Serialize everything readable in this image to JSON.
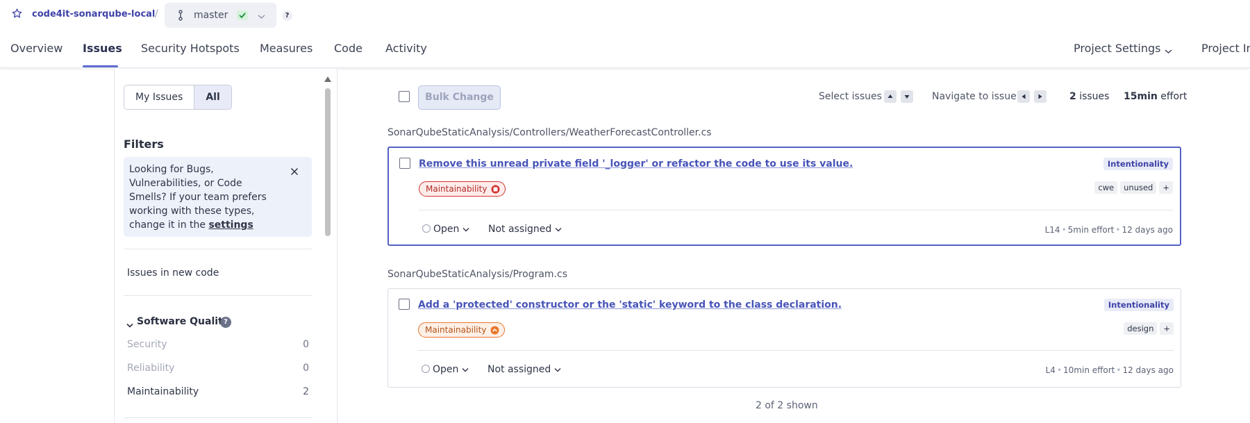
{
  "project": {
    "name": "code4it-sonarqube-local",
    "separator": "/",
    "branch": "master",
    "help": "?"
  },
  "nav": {
    "tabs": [
      "Overview",
      "Issues",
      "Security Hotspots",
      "Measures",
      "Code",
      "Activity"
    ],
    "active": "Issues",
    "project_settings": "Project Settings",
    "project_info": "Project In"
  },
  "sidebar": {
    "my_issues": "My Issues",
    "all": "All",
    "filters_title": "Filters",
    "hint": {
      "text": "Looking for Bugs, Vulnerabilities, or Code Smells? If your team prefers working with these types, change it in the ",
      "link": "settings"
    },
    "new_code": "Issues in new code",
    "software_quality": {
      "title": "Software Quality",
      "help": "?",
      "items": [
        {
          "label": "Security",
          "count": "0"
        },
        {
          "label": "Reliability",
          "count": "0"
        },
        {
          "label": "Maintainability",
          "count": "2"
        }
      ]
    }
  },
  "toolbar": {
    "bulk_change": "Bulk Change",
    "select_issues": "Select issues",
    "navigate_to_issue": "Navigate to issue",
    "issue_count": "2",
    "issue_count_label": "issues",
    "effort_value": "15min",
    "effort_label": "effort"
  },
  "issues": [
    {
      "file": "SonarQubeStaticAnalysis/Controllers/WeatherForecastController.cs",
      "title": "Remove this unread private field '_logger' or refactor the code to use its value.",
      "attribute": "Intentionality",
      "quality": "Maintainability",
      "severity_color": "#d3332d",
      "tags": [
        "cwe",
        "unused",
        "+"
      ],
      "status": "Open",
      "assignee": "Not assigned",
      "line": "L14",
      "effort": "5min effort",
      "age": "12 days ago"
    },
    {
      "file": "SonarQubeStaticAnalysis/Program.cs",
      "title": "Add a 'protected' constructor or the 'static' keyword to the class declaration.",
      "attribute": "Intentionality",
      "quality": "Maintainability",
      "severity_color": "#e8782b",
      "tags": [
        "design",
        "+"
      ],
      "status": "Open",
      "assignee": "Not assigned",
      "line": "L4",
      "effort": "10min effort",
      "age": "12 days ago"
    }
  ],
  "footer": {
    "shown": "2 of 2 shown"
  },
  "colors": {
    "accent": "#5d6cd0",
    "link": "#4754b8",
    "high_severity": "#d3332d",
    "medium_severity": "#e8782b"
  }
}
